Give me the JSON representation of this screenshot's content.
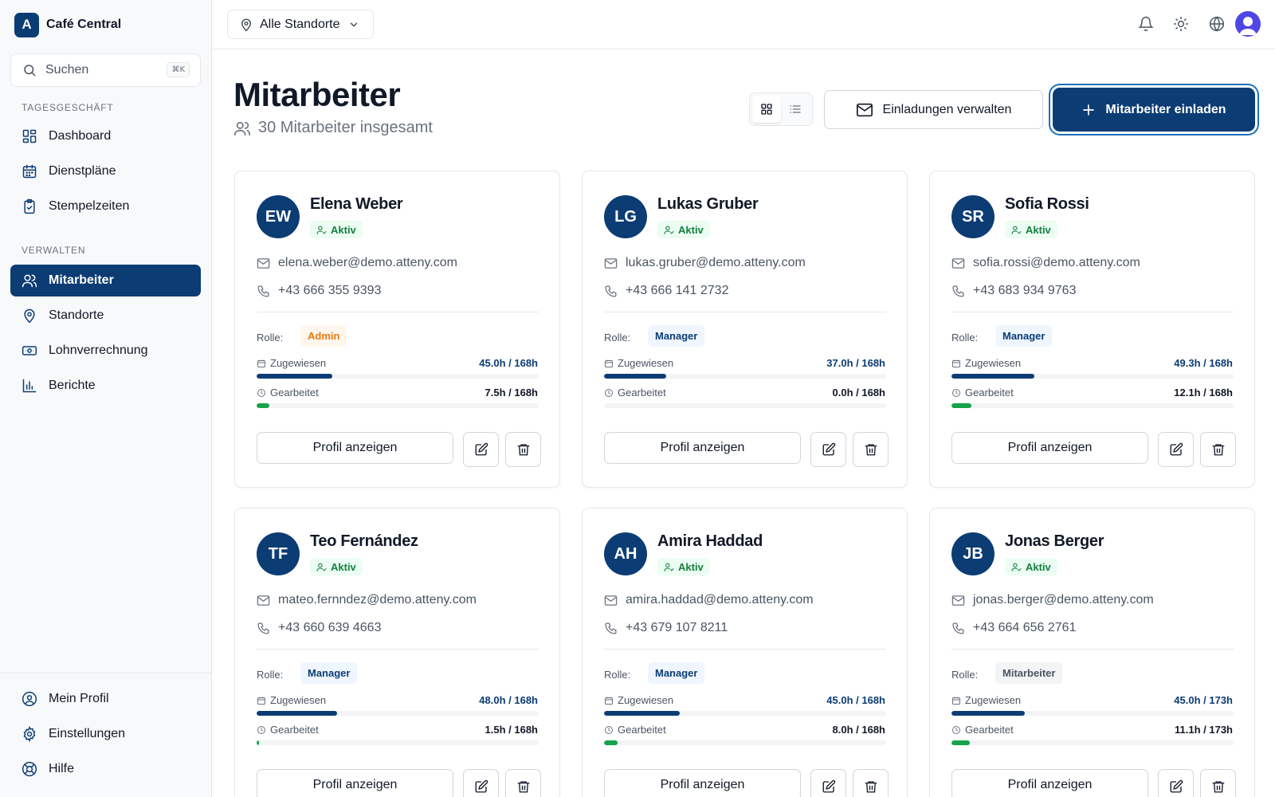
{
  "app": {
    "logo_letter": "A",
    "name": "Café Central"
  },
  "search": {
    "placeholder": "Suchen",
    "shortcut": "⌘K"
  },
  "sidebar": {
    "sections": [
      {
        "label": "TAGESGESCHÄFT"
      },
      {
        "label": "VERWALTEN"
      }
    ],
    "items": [
      {
        "label": "Dashboard",
        "icon": "dashboard-icon"
      },
      {
        "label": "Dienstpläne",
        "icon": "calendar-icon"
      },
      {
        "label": "Stempelzeiten",
        "icon": "clipboard-clock-icon"
      },
      {
        "label": "Mitarbeiter",
        "icon": "users-icon",
        "active": true
      },
      {
        "label": "Standorte",
        "icon": "map-pin-icon"
      },
      {
        "label": "Lohnverrechnung",
        "icon": "banknote-icon"
      },
      {
        "label": "Berichte",
        "icon": "bar-chart-icon"
      }
    ],
    "footer": [
      {
        "label": "Mein Profil",
        "icon": "user-circle-icon"
      },
      {
        "label": "Einstellungen",
        "icon": "gear-icon"
      },
      {
        "label": "Hilfe",
        "icon": "lifebuoy-icon"
      }
    ]
  },
  "header": {
    "location_select": "Alle Standorte"
  },
  "page": {
    "title": "Mitarbeiter",
    "subtitle": "30 Mitarbeiter insgesamt",
    "manage_invites_label": "Einladungen verwalten",
    "invite_label": "Mitarbeiter einladen"
  },
  "labels": {
    "role": "Rolle:",
    "assigned": "Zugewiesen",
    "worked": "Gearbeitet",
    "view_profile": "Profil anzeigen"
  },
  "colors": {
    "primary": "#0c3c74",
    "worked_bar": "#16a34a",
    "status_active": "#15803d",
    "role_admin": "#ea7a12",
    "role_manager": "#0c3c74"
  },
  "employees": [
    {
      "initials": "EW",
      "name": "Elena Weber",
      "status": "Aktiv",
      "email": "elena.weber@demo.atteny.com",
      "phone": "+43 666 355 9393",
      "role": "Admin",
      "assigned": "45.0h / 168h",
      "assigned_fraction": 0.268,
      "worked": "7.5h / 168h",
      "worked_fraction": 0.045
    },
    {
      "initials": "LG",
      "name": "Lukas Gruber",
      "status": "Aktiv",
      "email": "lukas.gruber@demo.atteny.com",
      "phone": "+43 666 141 2732",
      "role": "Manager",
      "assigned": "37.0h / 168h",
      "assigned_fraction": 0.22,
      "worked": "0.0h / 168h",
      "worked_fraction": 0.0
    },
    {
      "initials": "SR",
      "name": "Sofia Rossi",
      "status": "Aktiv",
      "email": "sofia.rossi@demo.atteny.com",
      "phone": "+43 683 934 9763",
      "role": "Manager",
      "assigned": "49.3h / 168h",
      "assigned_fraction": 0.293,
      "worked": "12.1h / 168h",
      "worked_fraction": 0.072
    },
    {
      "initials": "TF",
      "name": "Teo Fernández",
      "status": "Aktiv",
      "email": "mateo.fernndez@demo.atteny.com",
      "phone": "+43 660 639 4663",
      "role": "Manager",
      "assigned": "48.0h / 168h",
      "assigned_fraction": 0.286,
      "worked": "1.5h / 168h",
      "worked_fraction": 0.009
    },
    {
      "initials": "AH",
      "name": "Amira Haddad",
      "status": "Aktiv",
      "email": "amira.haddad@demo.atteny.com",
      "phone": "+43 679 107 8211",
      "role": "Manager",
      "assigned": "45.0h / 168h",
      "assigned_fraction": 0.268,
      "worked": "8.0h / 168h",
      "worked_fraction": 0.048
    },
    {
      "initials": "JB",
      "name": "Jonas Berger",
      "status": "Aktiv",
      "email": "jonas.berger@demo.atteny.com",
      "phone": "+43 664 656 2761",
      "role": "Mitarbeiter",
      "assigned": "45.0h / 173h",
      "assigned_fraction": 0.26,
      "worked": "11.1h / 173h",
      "worked_fraction": 0.064
    }
  ]
}
